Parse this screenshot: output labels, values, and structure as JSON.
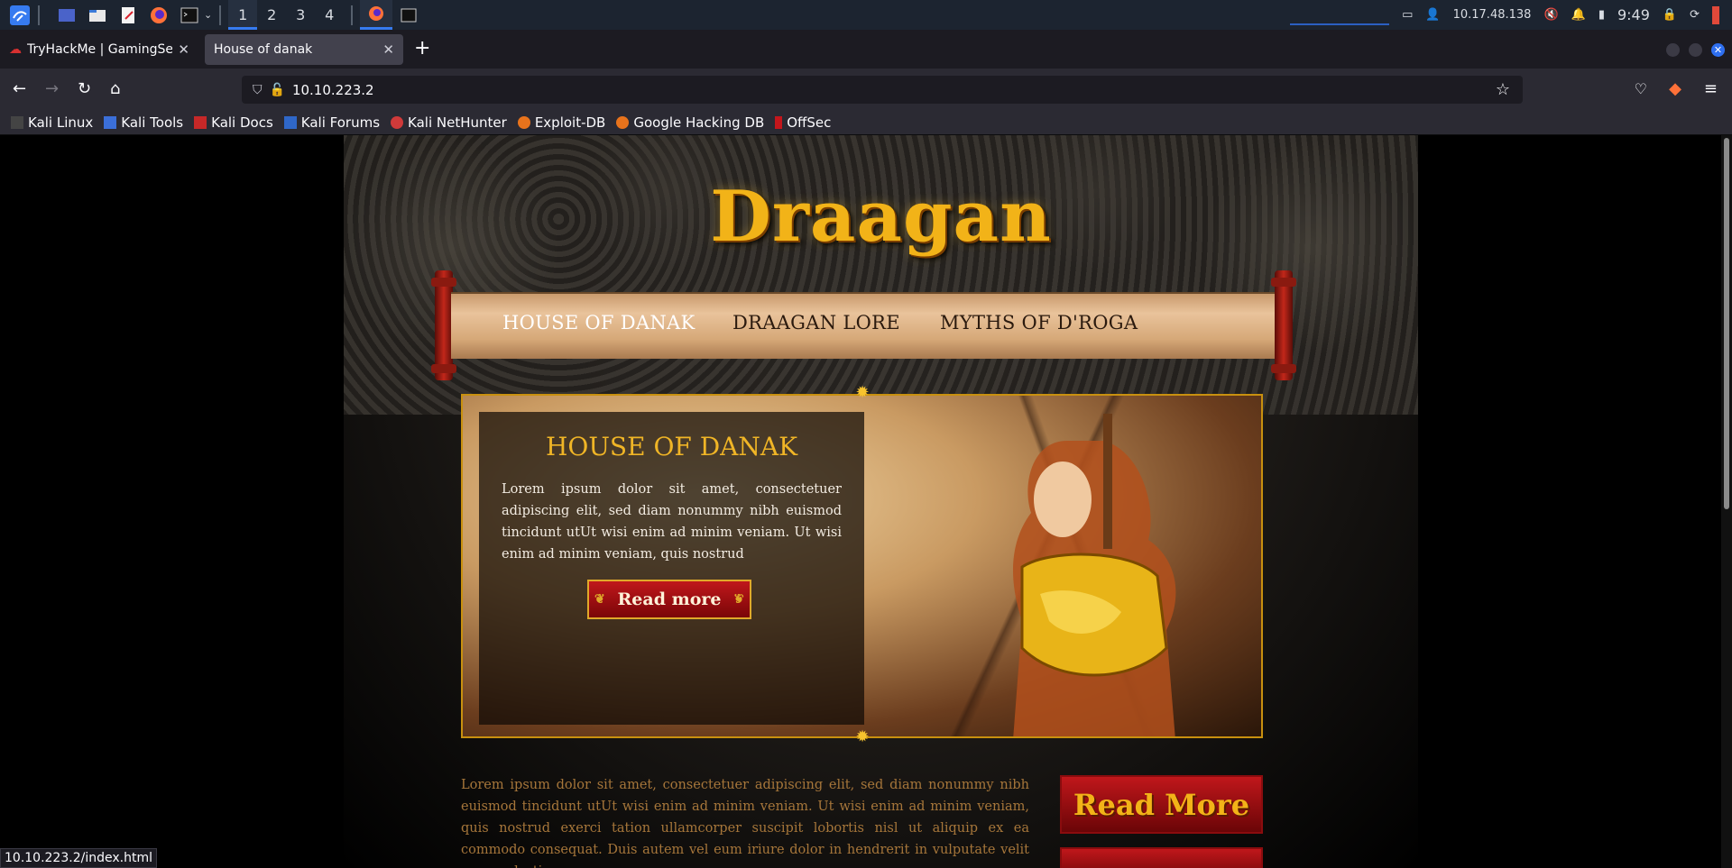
{
  "taskbar": {
    "workspaces": [
      "1",
      "2",
      "3",
      "4"
    ],
    "ip": "10.17.48.138",
    "clock": "9:49"
  },
  "tabs": [
    {
      "title": "TryHackMe | GamingServer",
      "active": false
    },
    {
      "title": "House of danak",
      "active": true
    }
  ],
  "url": "10.10.223.2",
  "bookmarks": [
    "Kali Linux",
    "Kali Tools",
    "Kali Docs",
    "Kali Forums",
    "Kali NetHunter",
    "Exploit-DB",
    "Google Hacking DB",
    "OffSec"
  ],
  "site": {
    "logo": "Draagan",
    "menu": [
      "HOUSE OF DANAK",
      "DRAAGAN LORE",
      "MYTHS OF D'ROGA"
    ],
    "hero": {
      "title": "HOUSE OF DANAK",
      "text": "Lorem ipsum dolor sit amet, consectetuer adipiscing elit, sed diam nonummy nibh euismod tincidunt utUt wisi enim ad minim veniam. Ut wisi enim ad minim veniam, quis nostrud",
      "button": "Read more"
    },
    "body_text": "Lorem ipsum dolor sit amet, consectetuer adipiscing elit, sed diam nonummy nibh euismod tincidunt utUt wisi enim ad minim veniam. Ut wisi enim ad minim veniam, quis nostrud exerci tation ullamcorper suscipit lobortis nisl ut aliquip ex ea commodo consequat. Duis autem vel eum iriure dolor in hendrerit in vulputate velit esse molestie",
    "side_button": "Read More"
  },
  "status_url": "10.10.223.2/index.html",
  "colors": {
    "accent": "#367bf0",
    "gold": "#f2b318",
    "crimson": "#c0171b"
  }
}
